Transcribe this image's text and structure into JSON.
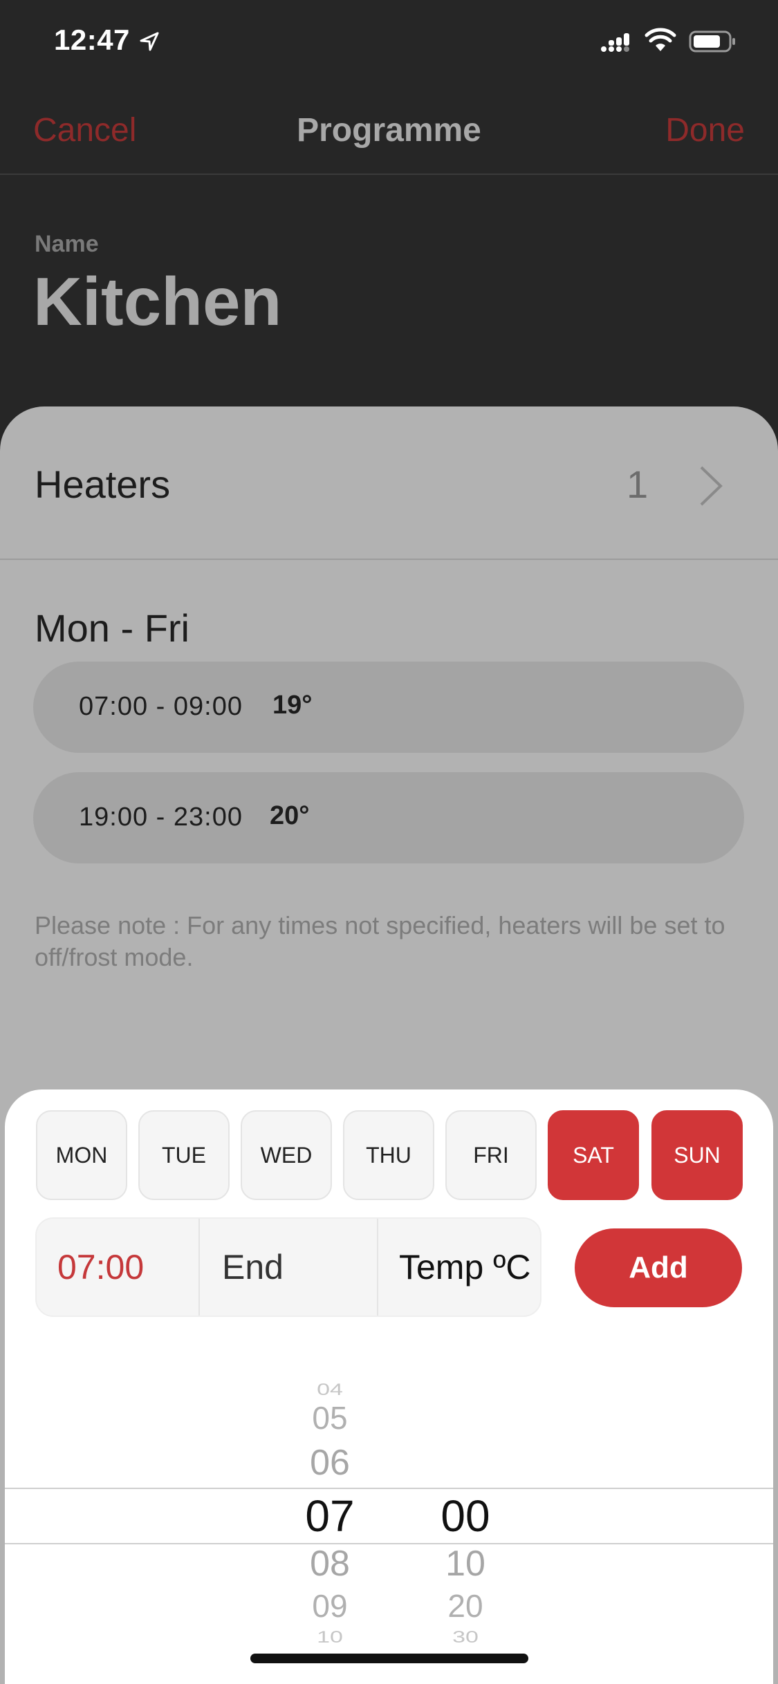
{
  "status_bar": {
    "time": "12:47"
  },
  "nav": {
    "cancel": "Cancel",
    "title": "Programme",
    "done": "Done"
  },
  "programme": {
    "name_label": "Name",
    "name": "Kitchen"
  },
  "heaters": {
    "label": "Heaters",
    "count": "1"
  },
  "schedule": {
    "header": "Mon - Fri",
    "slots": [
      {
        "time": "07:00 - 09:00",
        "temp": "19°"
      },
      {
        "time": "19:00 - 23:00",
        "temp": "20°"
      }
    ],
    "note": "Please note : For any times not specified, heaters will be set to off/frost mode."
  },
  "sheet": {
    "days": [
      {
        "label": "MON",
        "selected": false
      },
      {
        "label": "TUE",
        "selected": false
      },
      {
        "label": "WED",
        "selected": false
      },
      {
        "label": "THU",
        "selected": false
      },
      {
        "label": "FRI",
        "selected": false
      },
      {
        "label": "SAT",
        "selected": true
      },
      {
        "label": "SUN",
        "selected": true
      }
    ],
    "start_value": "07:00",
    "end_placeholder": "End",
    "temp_placeholder": "Temp ºC",
    "add_label": "Add"
  },
  "picker": {
    "hours": [
      "04",
      "05",
      "06",
      "07",
      "08",
      "09",
      "10"
    ],
    "selected_hour": "07",
    "minutes": [
      "00",
      "10",
      "20",
      "30"
    ],
    "selected_minute": "00"
  },
  "colors": {
    "accent": "#d13638",
    "dim_accent": "#8e2a2a"
  }
}
